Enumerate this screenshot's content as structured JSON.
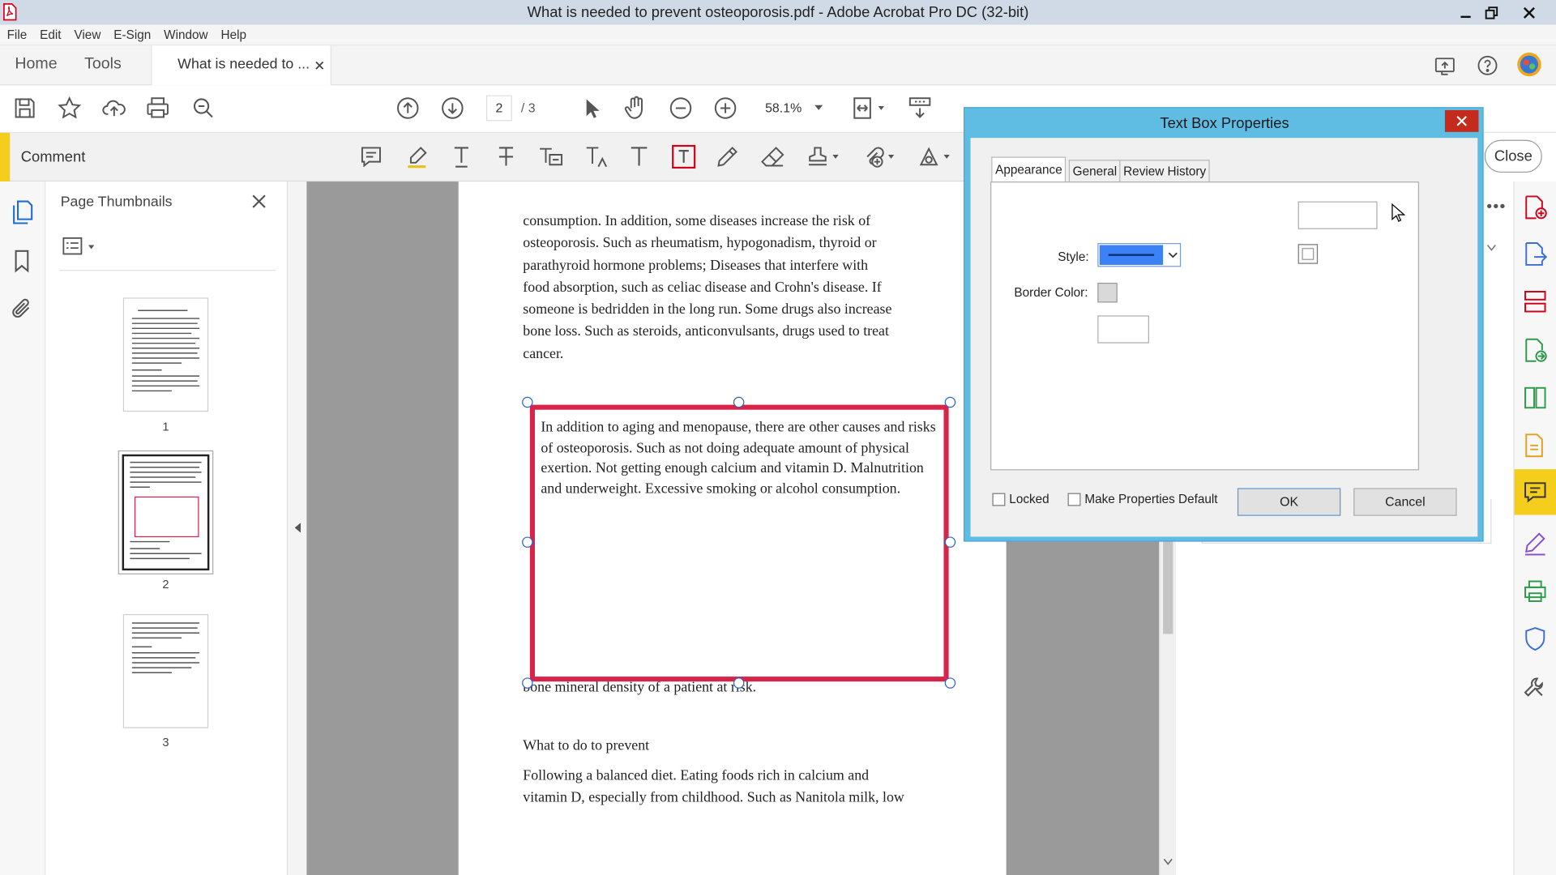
{
  "window": {
    "title": "What is needed to prevent osteoporosis.pdf - Adobe Acrobat Pro DC (32-bit)"
  },
  "menu": [
    "File",
    "Edit",
    "View",
    "E-Sign",
    "Window",
    "Help"
  ],
  "tabs": {
    "home": "Home",
    "tools": "Tools",
    "document": "What is needed to ..."
  },
  "toolbar": {
    "page_current": "2",
    "page_total": "/ 3",
    "zoom": "58.1%"
  },
  "comment_bar": {
    "label": "Comment",
    "close_label": "Close"
  },
  "thumbnails": {
    "title": "Page Thumbnails",
    "pages": [
      "1",
      "2",
      "3"
    ]
  },
  "document": {
    "paragraph_top": [
      "consumption. In addition, some diseases increase the risk of",
      "osteoporosis. Such as rheumatism, hypogonadism, thyroid or",
      "parathyroid hormone problems; Diseases that interfere with",
      "food absorption, such as celiac disease and Crohn's disease. If",
      "someone is bedridden in the long run. Some drugs also increase",
      "bone loss. Such as steroids, anticonvulsants, drugs used to treat",
      "cancer."
    ],
    "obscured_line": "bone mineral density of a patient at risk.",
    "heading": "What to do to prevent",
    "paragraph_bottom": [
      "Following a balanced diet. Eating foods rich in calcium and",
      "vitamin D, especially from childhood. Such as Nanitola milk, low"
    ],
    "textbox": "In addition to aging and menopause, there are other causes and risks of osteoporosis. Such as not doing adequate amount of physical exertion. Not getting enough calcium and vitamin D. Malnutrition and underweight. Excessive smoking or alcohol consumption."
  },
  "dialog": {
    "title": "Text Box Properties",
    "tabs": [
      "Appearance",
      "General",
      "Review History"
    ],
    "style_label": "Style:",
    "border_color_label": "Border Color:",
    "locked_label": "Locked",
    "make_default_label": "Make Properties Default",
    "ok_label": "OK",
    "cancel_label": "Cancel"
  },
  "colors": {
    "accent_yellow": "#f5cd1b",
    "textbox_border": "#d8244a",
    "dialog_frame": "#5fbde4",
    "style_swatch": "#3b82f6"
  }
}
